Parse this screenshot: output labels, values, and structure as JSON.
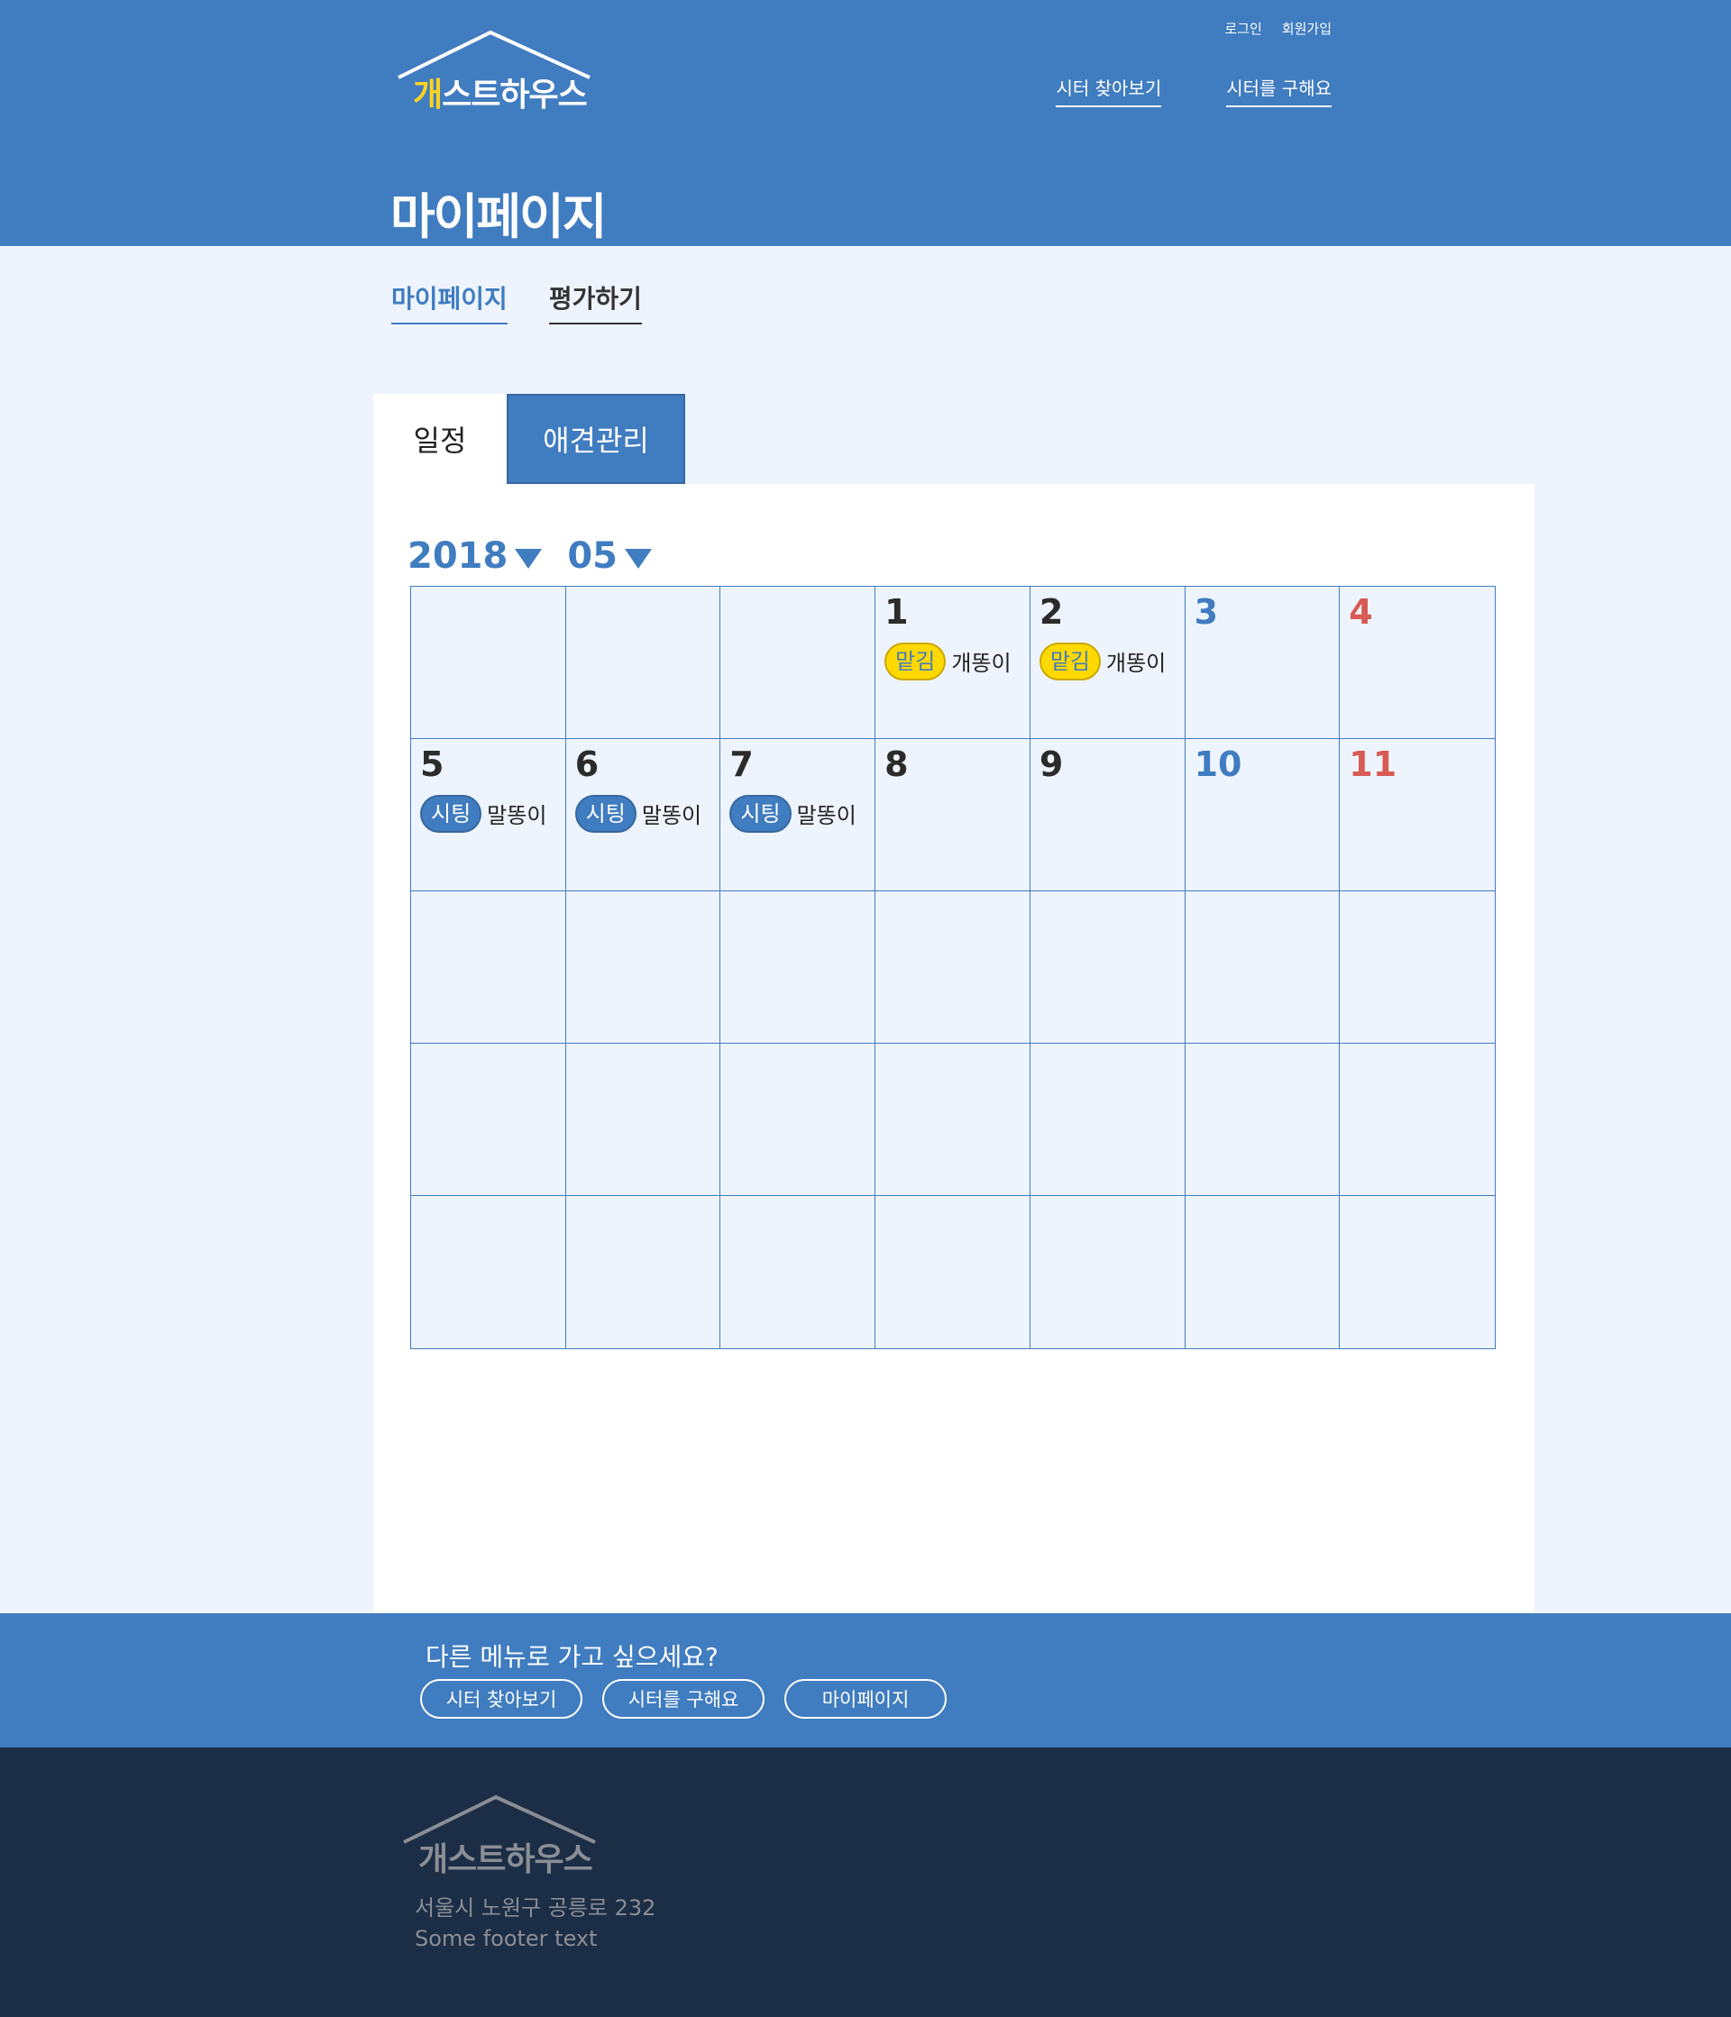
{
  "header": {
    "logo_text_first": "개",
    "logo_text_rest": "스트하우스",
    "top_links": [
      "로그인",
      "회원가입"
    ],
    "nav": [
      "시터 찾아보기",
      "시터를 구해요"
    ],
    "page_title": "마이페이지"
  },
  "subnav": {
    "active": "마이페이지",
    "other": "평가하기"
  },
  "tabs": {
    "schedule": "일정",
    "pet": "애견관리"
  },
  "calendar": {
    "year": "2018",
    "month": "05",
    "cells": [
      {
        "day": "",
        "type": ""
      },
      {
        "day": "",
        "type": ""
      },
      {
        "day": "",
        "type": ""
      },
      {
        "day": "1",
        "type": "",
        "badge": "맡김",
        "badge_type": "entrust",
        "name": "개똥이"
      },
      {
        "day": "2",
        "type": "",
        "badge": "맡김",
        "badge_type": "entrust",
        "name": "개똥이"
      },
      {
        "day": "3",
        "type": "sat"
      },
      {
        "day": "4",
        "type": "sun"
      },
      {
        "day": "5",
        "type": "",
        "badge": "시팅",
        "badge_type": "sitting",
        "name": "말똥이"
      },
      {
        "day": "6",
        "type": "",
        "badge": "시팅",
        "badge_type": "sitting",
        "name": "말똥이"
      },
      {
        "day": "7",
        "type": "",
        "badge": "시팅",
        "badge_type": "sitting",
        "name": "말똥이"
      },
      {
        "day": "8",
        "type": ""
      },
      {
        "day": "9",
        "type": ""
      },
      {
        "day": "10",
        "type": "sat"
      },
      {
        "day": "11",
        "type": "sun"
      },
      {
        "day": ""
      },
      {
        "day": ""
      },
      {
        "day": ""
      },
      {
        "day": ""
      },
      {
        "day": ""
      },
      {
        "day": ""
      },
      {
        "day": ""
      },
      {
        "day": ""
      },
      {
        "day": ""
      },
      {
        "day": ""
      },
      {
        "day": ""
      },
      {
        "day": ""
      },
      {
        "day": ""
      },
      {
        "day": ""
      },
      {
        "day": ""
      },
      {
        "day": ""
      },
      {
        "day": ""
      },
      {
        "day": ""
      },
      {
        "day": ""
      },
      {
        "day": ""
      },
      {
        "day": ""
      }
    ]
  },
  "menu": {
    "question": "다른 메뉴로 가고 싶으세요?",
    "buttons": [
      "시터 찾아보기",
      "시터를 구해요",
      "마이페이지"
    ]
  },
  "footer": {
    "logo_text_first": "개",
    "logo_text_rest": "스트하우스",
    "address": "서울시 노원구 공릉로 232",
    "text": "Some footer text"
  },
  "colors": {
    "primary": "#407cc0",
    "accent_yellow": "#ffd800",
    "sunday_red": "#d85a54",
    "footer_bg": "#1c2e45",
    "page_bg": "#eef4fd"
  }
}
